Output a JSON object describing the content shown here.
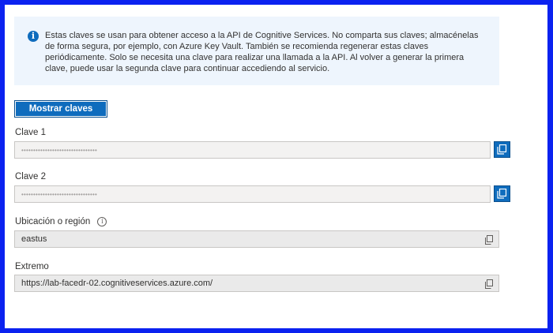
{
  "info": {
    "icon": "info-circle-icon",
    "text": "Estas claves se usan para obtener acceso a la API de Cognitive Services. No comparta sus claves; almacénelas de forma segura, por ejemplo, con Azure Key Vault. También se recomienda regenerar estas claves periódicamente. Solo se necesita una clave para realizar una llamada a la API. Al volver a generar la primera clave, puede usar la segunda clave para continuar accediendo al servicio."
  },
  "show_keys_button": "Mostrar claves",
  "key1": {
    "label": "Clave 1",
    "value": "••••••••••••••••••••••••••••••••",
    "copy_icon": "copy-icon"
  },
  "key2": {
    "label": "Clave 2",
    "value": "••••••••••••••••••••••••••••••••",
    "copy_icon": "copy-icon"
  },
  "location": {
    "label": "Ubicación o región",
    "value": "eastus",
    "info_icon": "info-icon",
    "copy_icon": "copy-icon"
  },
  "endpoint": {
    "label": "Extremo",
    "value": "https://lab-facedr-02.cognitiveservices.azure.com/",
    "copy_icon": "copy-icon"
  },
  "colors": {
    "border": "#0b22f0",
    "accent": "#0f6cbd",
    "info_bg": "#eef5fd"
  }
}
